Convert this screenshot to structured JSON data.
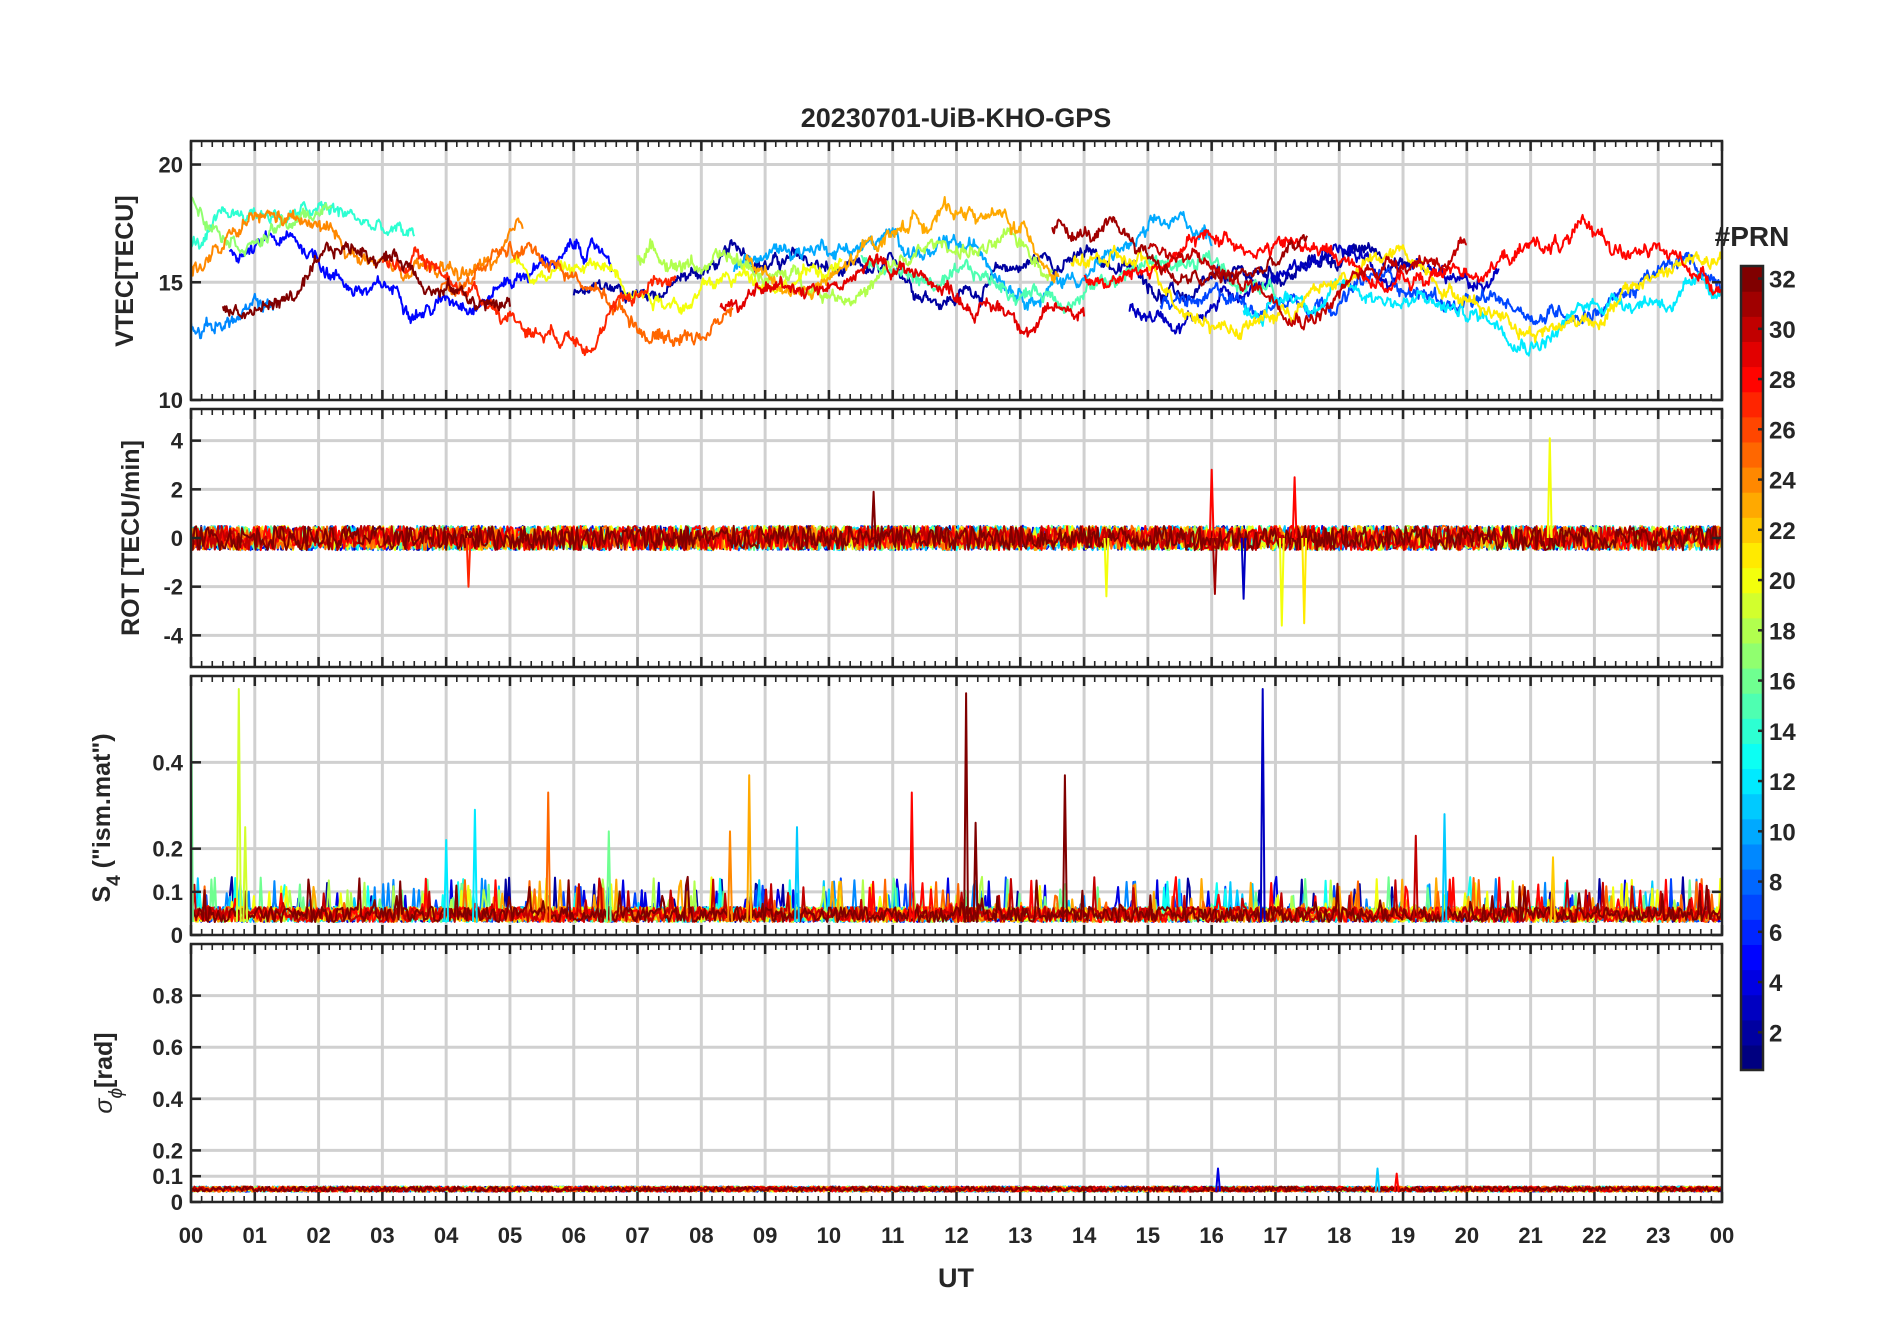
{
  "figure_title": "20230701-UiB-KHO-GPS",
  "colorbar": {
    "label": "#PRN",
    "range": [
      1,
      32
    ],
    "tick_labels": [
      "2",
      "4",
      "6",
      "8",
      "10",
      "12",
      "14",
      "16",
      "18",
      "20",
      "22",
      "24",
      "26",
      "28",
      "30",
      "32"
    ],
    "colormap": "jet"
  },
  "chart_data": [
    {
      "panel": "vtec",
      "type": "line",
      "ylabel": "VTEC[TECU]",
      "ylim": [
        10,
        21
      ],
      "yticks": [
        10,
        15,
        20
      ],
      "ytick_labels": [
        "10",
        "15",
        "20"
      ],
      "xlim": [
        0,
        24
      ],
      "grid": true,
      "series": [
        {
          "prn": 2,
          "start": 6.0,
          "end": 19.2,
          "base": 15.2,
          "amp": 1.3
        },
        {
          "prn": 3,
          "start": 14.7,
          "end": 20.5,
          "base": 15.0,
          "amp": 1.8
        },
        {
          "prn": 5,
          "start": 0.6,
          "end": 6.6,
          "base": 15.5,
          "amp": 1.5
        },
        {
          "prn": 7,
          "start": 15.2,
          "end": 24.0,
          "base": 14.5,
          "amp": 1.3
        },
        {
          "prn": 9,
          "start": 0.0,
          "end": 1.3,
          "base": 13.5,
          "amp": 0.7
        },
        {
          "prn": 10,
          "start": 8.5,
          "end": 16.0,
          "base": 16.2,
          "amp": 1.0
        },
        {
          "prn": 12,
          "start": 16.5,
          "end": 24.0,
          "base": 14.2,
          "amp": 1.0
        },
        {
          "prn": 14,
          "start": 0.0,
          "end": 3.5,
          "base": 17.0,
          "amp": 1.2
        },
        {
          "prn": 15,
          "start": 10.5,
          "end": 17.0,
          "base": 15.2,
          "amp": 1.2
        },
        {
          "prn": 17,
          "start": 0.0,
          "end": 2.2,
          "base": 18.4,
          "amp": 0.7
        },
        {
          "prn": 18,
          "start": 7.0,
          "end": 13.5,
          "base": 15.7,
          "amp": 1.0
        },
        {
          "prn": 20,
          "start": 5.0,
          "end": 10.2,
          "base": 15.6,
          "amp": 0.6
        },
        {
          "prn": 21,
          "start": 13.8,
          "end": 24.0,
          "base": 14.8,
          "amp": 1.5
        },
        {
          "prn": 23,
          "start": 8.7,
          "end": 13.6,
          "base": 16.5,
          "amp": 2.5
        },
        {
          "prn": 24,
          "start": 0.0,
          "end": 5.2,
          "base": 15.8,
          "amp": 1.6
        },
        {
          "prn": 25,
          "start": 3.9,
          "end": 8.5,
          "base": 14.8,
          "amp": 2.2
        },
        {
          "prn": 27,
          "start": 3.0,
          "end": 7.6,
          "base": 14.8,
          "amp": 1.8
        },
        {
          "prn": 28,
          "start": 14.0,
          "end": 24.0,
          "base": 16.0,
          "amp": 1.2
        },
        {
          "prn": 29,
          "start": 8.3,
          "end": 14.0,
          "base": 14.8,
          "amp": 1.2
        },
        {
          "prn": 30,
          "start": 15.0,
          "end": 20.0,
          "base": 15.6,
          "amp": 1.5
        },
        {
          "prn": 31,
          "start": 13.5,
          "end": 17.5,
          "base": 16.0,
          "amp": 1.7
        },
        {
          "prn": 32,
          "start": 0.5,
          "end": 5.0,
          "base": 15.0,
          "amp": 1.4
        }
      ]
    },
    {
      "panel": "rot",
      "type": "line",
      "ylabel": "ROT [TECU/min]",
      "ylim": [
        -5.3,
        5.3
      ],
      "yticks": [
        -4,
        -2,
        0,
        2,
        4
      ],
      "ytick_labels": [
        "-4",
        "-2",
        "0",
        "2",
        "4"
      ],
      "xlim": [
        0,
        24
      ],
      "grid": true,
      "noise_amplitude": 0.5,
      "spikes": [
        {
          "t": 4.35,
          "v": -2.0,
          "prn": 27
        },
        {
          "t": 10.7,
          "v": 1.9,
          "prn": 32
        },
        {
          "t": 14.35,
          "v": -2.4,
          "prn": 20
        },
        {
          "t": 16.0,
          "v": 2.8,
          "prn": 28
        },
        {
          "t": 16.05,
          "v": -2.3,
          "prn": 31
        },
        {
          "t": 16.5,
          "v": -2.5,
          "prn": 3
        },
        {
          "t": 17.1,
          "v": -3.6,
          "prn": 20
        },
        {
          "t": 17.3,
          "v": 2.5,
          "prn": 28
        },
        {
          "t": 17.45,
          "v": -3.5,
          "prn": 21
        },
        {
          "t": 21.3,
          "v": 4.1,
          "prn": 20
        }
      ]
    },
    {
      "panel": "s4",
      "type": "line",
      "ylabel": "S",
      "ylabel_subscript": "4",
      "ylabel_suffix": " (\"ism.mat\")",
      "ylim": [
        0,
        0.6
      ],
      "yticks": [
        0,
        0.1,
        0.2,
        0.4
      ],
      "ytick_labels": [
        "0",
        "0.1",
        "0.2",
        "0.4"
      ],
      "xlim": [
        0,
        24
      ],
      "grid": true,
      "baseline": 0.03,
      "spikes": [
        {
          "t": 0.0,
          "v": 0.58,
          "prn": 16
        },
        {
          "t": 0.75,
          "v": 0.57,
          "prn": 19
        },
        {
          "t": 0.85,
          "v": 0.25,
          "prn": 19
        },
        {
          "t": 4.0,
          "v": 0.22,
          "prn": 12
        },
        {
          "t": 4.45,
          "v": 0.29,
          "prn": 12
        },
        {
          "t": 5.6,
          "v": 0.33,
          "prn": 25
        },
        {
          "t": 6.55,
          "v": 0.24,
          "prn": 16
        },
        {
          "t": 8.45,
          "v": 0.24,
          "prn": 24
        },
        {
          "t": 8.75,
          "v": 0.37,
          "prn": 23
        },
        {
          "t": 9.5,
          "v": 0.25,
          "prn": 11
        },
        {
          "t": 11.3,
          "v": 0.33,
          "prn": 28
        },
        {
          "t": 12.15,
          "v": 0.56,
          "prn": 32
        },
        {
          "t": 12.3,
          "v": 0.26,
          "prn": 32
        },
        {
          "t": 13.7,
          "v": 0.37,
          "prn": 32
        },
        {
          "t": 16.8,
          "v": 0.57,
          "prn": 3
        },
        {
          "t": 19.2,
          "v": 0.23,
          "prn": 30
        },
        {
          "t": 19.65,
          "v": 0.28,
          "prn": 11
        },
        {
          "t": 21.35,
          "v": 0.18,
          "prn": 22
        }
      ]
    },
    {
      "panel": "sigma_phi",
      "type": "line",
      "ylabel": "σ",
      "ylabel_subscript": "ϕ",
      "ylabel_suffix": "[rad]",
      "ylim": [
        0,
        1.0
      ],
      "yticks": [
        0,
        0.1,
        0.2,
        0.4,
        0.6,
        0.8
      ],
      "ytick_labels": [
        "0",
        "0.1",
        "0.2",
        "0.4",
        "0.6",
        "0.8"
      ],
      "xlim": [
        0,
        24
      ],
      "grid": true,
      "baseline": 0.04,
      "spikes": [
        {
          "t": 16.1,
          "v": 0.13,
          "prn": 4
        },
        {
          "t": 18.6,
          "v": 0.13,
          "prn": 11
        },
        {
          "t": 18.9,
          "v": 0.11,
          "prn": 28
        }
      ]
    }
  ],
  "xaxis": {
    "label": "UT",
    "tick_labels": [
      "00",
      "01",
      "02",
      "03",
      "04",
      "05",
      "06",
      "07",
      "08",
      "09",
      "10",
      "11",
      "12",
      "13",
      "14",
      "15",
      "16",
      "17",
      "18",
      "19",
      "20",
      "21",
      "22",
      "23",
      "00"
    ]
  }
}
